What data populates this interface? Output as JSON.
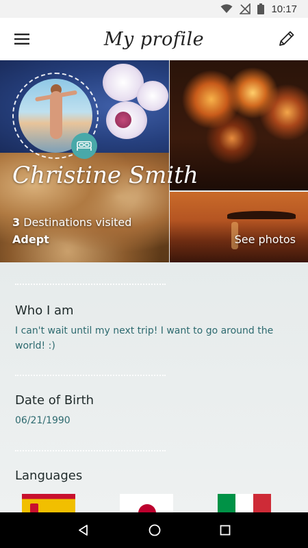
{
  "status_bar": {
    "time": "10:17"
  },
  "app_bar": {
    "title": "My profile",
    "menu_icon": "hamburger-menu-icon",
    "edit_icon": "pencil-icon"
  },
  "hero": {
    "name": "Christine Smith",
    "destinations_count": "3",
    "destinations_label": " Destinations visited",
    "level": "Adept",
    "see_photos": "See photos",
    "badge_icon": "bed-icon"
  },
  "sections": {
    "who_title": "Who I am",
    "who_text": "I can't wait until my next trip! I want to go around the world! :)",
    "dob_title": "Date of Birth",
    "dob_value": "06/21/1990",
    "languages_title": "Languages"
  },
  "languages": [
    {
      "flag": "spain-flag",
      "colors": [
        "#c8102e",
        "#f1bf00"
      ]
    },
    {
      "flag": "japan-flag",
      "colors": [
        "#ffffff",
        "#bc002d"
      ]
    },
    {
      "flag": "italy-flag",
      "colors": [
        "#009246",
        "#ffffff",
        "#ce2b37"
      ]
    }
  ],
  "colors": {
    "accent_teal": "#49a9a9",
    "text_teal": "#2d6a6f"
  }
}
